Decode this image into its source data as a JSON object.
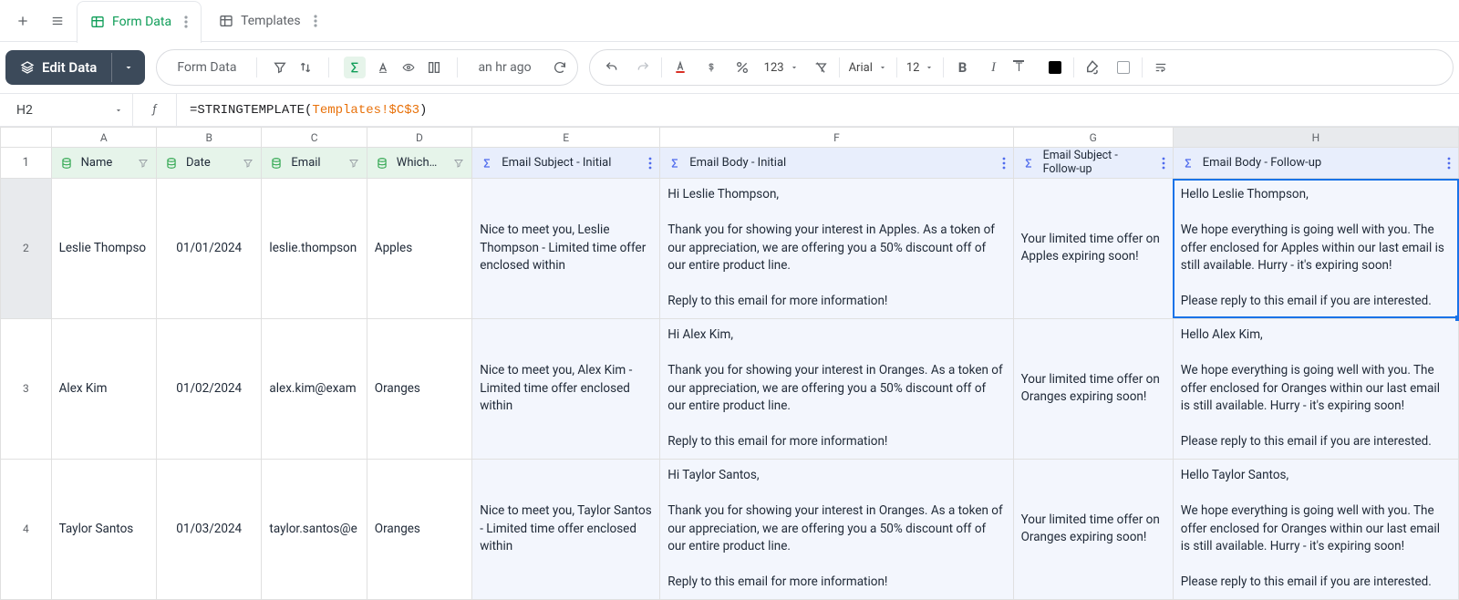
{
  "tabs": {
    "formData": "Form Data",
    "templates": "Templates"
  },
  "toolbar": {
    "editData": "Edit Data",
    "currentSheet": "Form Data",
    "timeAgo": "an hr ago",
    "numberFmt": "123",
    "font": "Arial",
    "fontSize": "12"
  },
  "formulaBar": {
    "cellRef": "H2",
    "prefix": "=STRINGTEMPLATE(",
    "ref": "Templates!$C$3",
    "suffix": ")"
  },
  "columnsLetters": [
    "A",
    "B",
    "C",
    "D",
    "E",
    "F",
    "G",
    "H"
  ],
  "headers": {
    "A": "Name",
    "B": "Date",
    "C": "Email",
    "D": "Which…",
    "E": "Email Subject - Initial",
    "F": "Email Body - Initial",
    "G": "Email Subject - Follow-up",
    "H": "Email Body - Follow-up"
  },
  "rows": [
    {
      "num": "2",
      "A": "Leslie Thompso",
      "B": "01/01/2024",
      "C": "leslie.thompson",
      "D": "Apples",
      "E": "Nice to meet you, Leslie Thompson - Limited time offer enclosed within",
      "F": "Hi Leslie Thompson,\n\nThank you for showing your interest in Apples. As a token of our appreciation, we are offering you a 50% discount off of our entire product line.\n\nReply to this email for more information!",
      "G": "Your limited time offer on Apples expiring soon!",
      "H": "Hello Leslie Thompson,\n\nWe hope everything is going well with you. The offer enclosed for Apples within our last email is still available. Hurry - it's expiring soon!\n\nPlease reply to this email if you are interested."
    },
    {
      "num": "3",
      "A": "Alex Kim",
      "B": "01/02/2024",
      "C": "alex.kim@exam",
      "D": "Oranges",
      "E": "Nice to meet you, Alex Kim - Limited time offer enclosed within",
      "F": "Hi Alex Kim,\n\nThank you for showing your interest in Oranges. As a token of our appreciation, we are offering you a 50% discount off of our entire product line.\n\nReply to this email for more information!",
      "G": "Your limited time offer on Oranges expiring soon!",
      "H": "Hello Alex Kim,\n\nWe hope everything is going well with you. The offer enclosed for Oranges within our last email is still available. Hurry - it's expiring soon!\n\nPlease reply to this email if you are interested."
    },
    {
      "num": "4",
      "A": "Taylor Santos",
      "B": "01/03/2024",
      "C": "taylor.santos@e",
      "D": "Oranges",
      "E": "Nice to meet you, Taylor Santos - Limited time offer enclosed within",
      "F": "Hi Taylor Santos,\n\nThank you for showing your interest in Oranges. As a token of our appreciation, we are offering you a 50% discount off of our entire product line.\n\nReply to this email for more information!",
      "G": "Your limited time offer on Oranges expiring soon!",
      "H": "Hello Taylor Santos,\n\nWe hope everything is going well with you. The offer enclosed for Oranges within our last email is still available. Hurry - it's expiring soon!\n\nPlease reply to this email if you are interested."
    }
  ]
}
